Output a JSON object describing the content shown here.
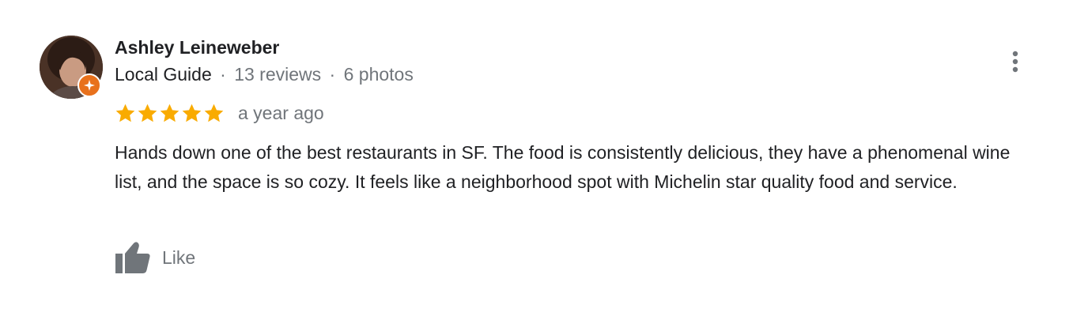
{
  "review": {
    "author": {
      "name": "Ashley Leineweber",
      "badge": "Local Guide",
      "separator": "·",
      "reviews_count": "13 reviews",
      "photos_count": "6 photos"
    },
    "rating": {
      "stars": 5,
      "max_stars": 5,
      "star_color": "#f9ab00"
    },
    "date": "a year ago",
    "text": "Hands down one of the best restaurants in SF. The food is consistently delicious, they have a phenomenal wine list, and the space is so cozy. It feels like a neighborhood spot with Michelin star quality food and service.",
    "actions": {
      "like_label": "Like"
    },
    "icons": {
      "more": "more-vertical-icon",
      "like": "thumbs-up-icon",
      "guide_badge": "local-guide-star-icon"
    },
    "colors": {
      "badge": "#e8711c",
      "secondary_text": "#70757a",
      "primary_text": "#202124"
    }
  }
}
